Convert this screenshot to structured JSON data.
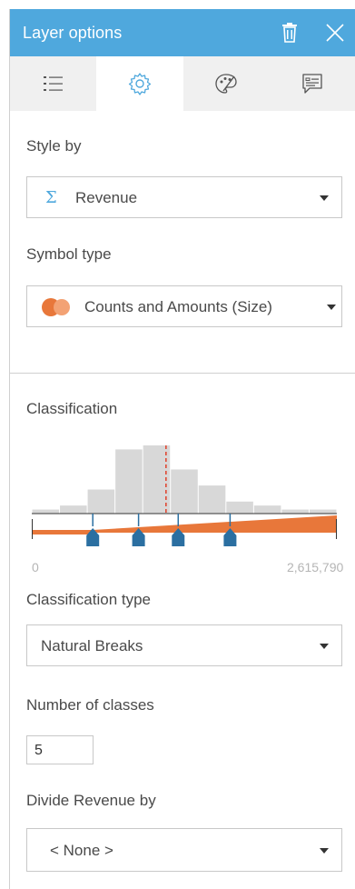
{
  "header": {
    "title": "Layer options",
    "trash_icon": "trash-icon",
    "close_icon": "close-icon",
    "bg_color": "#4fa8dd"
  },
  "tabs": [
    {
      "icon": "legend-list-icon",
      "active": false
    },
    {
      "icon": "gear-icon",
      "active": true
    },
    {
      "icon": "palette-icon",
      "active": false
    },
    {
      "icon": "popup-icon",
      "active": false
    }
  ],
  "style_by": {
    "label": "Style by",
    "value": "Revenue",
    "field_icon": "sigma-icon"
  },
  "symbol_type": {
    "label": "Symbol type",
    "value": "Counts and Amounts (Size)",
    "icon": "size-circles-icon",
    "accent_color": "#e8773a"
  },
  "classification": {
    "label": "Classification",
    "axis_min": "0",
    "axis_max": "2,615,790",
    "histogram_bar_color": "#d8d8d8",
    "classes_color": "#e8773a",
    "handle_color": "#2b6fa1",
    "mean_line_color": "#e0402a",
    "histogram_counts": [
      1,
      2,
      6,
      16,
      17,
      11,
      7,
      3,
      2,
      1,
      1
    ],
    "class_breaks_fraction": [
      0.2,
      0.35,
      0.48,
      0.65
    ]
  },
  "classification_type": {
    "label": "Classification type",
    "value": "Natural Breaks"
  },
  "number_of_classes": {
    "label": "Number of classes",
    "value": "5"
  },
  "divide_by": {
    "label": "Divide Revenue by",
    "value": "< None >"
  }
}
